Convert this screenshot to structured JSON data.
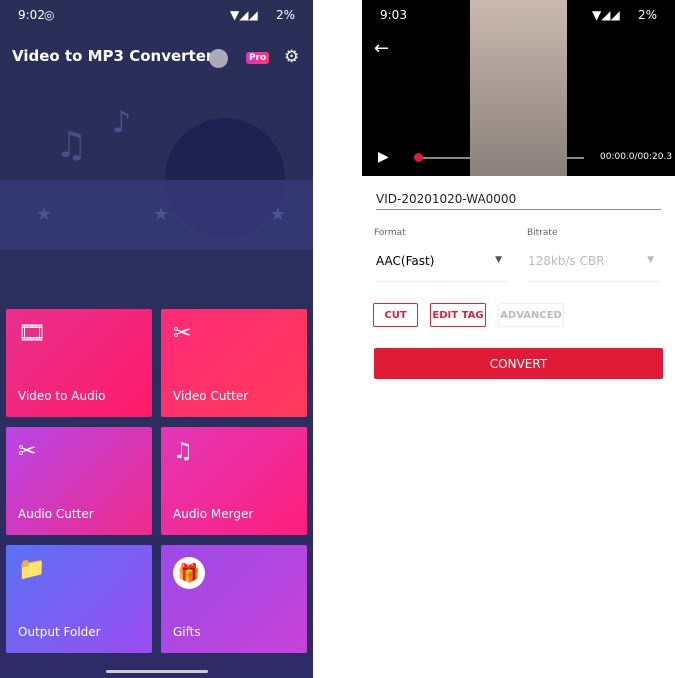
{
  "left": {
    "status": {
      "time": "9:02",
      "battery": "2%"
    },
    "title": "Video to MP3 Converter",
    "pro_badge": "Pro",
    "tiles": [
      {
        "label": "Video to Audio",
        "icon": "video-audio-icon"
      },
      {
        "label": "Video Cutter",
        "icon": "scissors-film-icon"
      },
      {
        "label": "Audio Cutter",
        "icon": "scissors-note-icon"
      },
      {
        "label": "Audio Merger",
        "icon": "merge-note-icon"
      },
      {
        "label": "Output Folder",
        "icon": "folder-arrow-icon"
      },
      {
        "label": "Gifts",
        "icon": "gift-icon"
      }
    ]
  },
  "right": {
    "status": {
      "time": "9:03",
      "battery": "2%"
    },
    "player": {
      "time": "00:00.0/00:20.3",
      "progress": 0
    },
    "filename": "VID-20201020-WA0000",
    "format_label": "Format",
    "format_value": "AAC(Fast)",
    "bitrate_label": "Bitrate",
    "bitrate_value": "128kb/s CBR",
    "buttons": {
      "cut": "CUT",
      "edit_tag": "EDIT TAG",
      "advanced": "ADVANCED",
      "convert": "CONVERT"
    }
  },
  "colors": {
    "accent": "#e01b38",
    "bg_dark": "#2a2f58"
  }
}
